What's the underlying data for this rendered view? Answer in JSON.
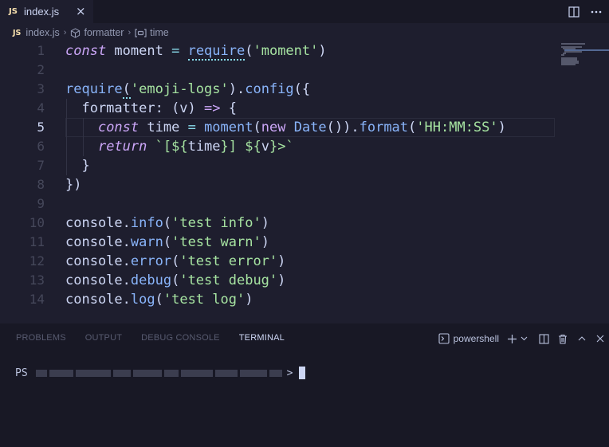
{
  "tab": {
    "badge": "JS",
    "filename": "index.js",
    "close": "×"
  },
  "breadcrumb": {
    "badge": "JS",
    "file": "index.js",
    "symbol1": "formatter",
    "symbol2": "time"
  },
  "editor": {
    "active_line": 5,
    "line_numbers": [
      "1",
      "2",
      "3",
      "4",
      "5",
      "6",
      "7",
      "8",
      "9",
      "10",
      "11",
      "12",
      "13",
      "14"
    ],
    "lines": {
      "l1": [
        "const",
        " moment ",
        "=",
        " ",
        "require",
        "(",
        "'moment'",
        ")"
      ],
      "l3": [
        "require",
        "(",
        "'emoji-logs'",
        ").",
        "config",
        "({"
      ],
      "l4": [
        "  formatter: ",
        "(v)",
        " ",
        "=>",
        " {"
      ],
      "l5": [
        "    ",
        "const",
        " time ",
        "=",
        " ",
        "moment",
        "(",
        "new",
        " ",
        "Date",
        "()).",
        "format",
        "(",
        "'HH:MM:SS'",
        ")"
      ],
      "l6": [
        "    ",
        "return",
        " ",
        "`[${",
        "time",
        "}] ${",
        "v",
        "}>`"
      ],
      "l7": [
        "  }"
      ],
      "l8": [
        "})"
      ],
      "l10": [
        "console.",
        "info",
        "(",
        "'test info'",
        ")"
      ],
      "l11": [
        "console.",
        "warn",
        "(",
        "'test warn'",
        ")"
      ],
      "l12": [
        "console.",
        "error",
        "(",
        "'test error'",
        ")"
      ],
      "l13": [
        "console.",
        "debug",
        "(",
        "'test debug'",
        ")"
      ],
      "l14": [
        "console.",
        "log",
        "(",
        "'test log'",
        ")"
      ]
    }
  },
  "panel": {
    "tabs": [
      "PROBLEMS",
      "OUTPUT",
      "DEBUG CONSOLE",
      "TERMINAL"
    ],
    "active_tab": "TERMINAL",
    "shell_label": "powershell",
    "terminal": {
      "prompt": "PS",
      "suffix": ">"
    }
  },
  "colors": {
    "background": "#1e1e2e",
    "keyword": "#cba6f7",
    "function": "#89b4fa",
    "string": "#a6e3a1",
    "class": "#f9e2af"
  }
}
